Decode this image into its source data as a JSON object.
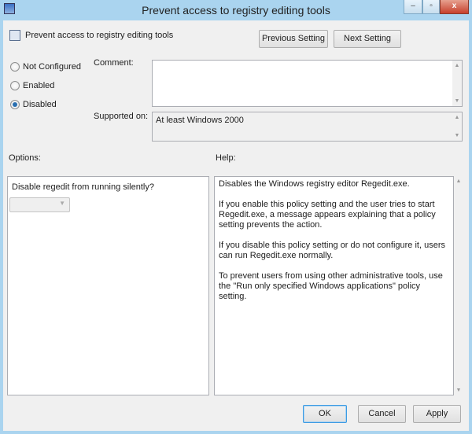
{
  "window": {
    "title": "Prevent access to registry editing tools",
    "minimize": "–",
    "maximize": "▫",
    "close": "x"
  },
  "header": {
    "policy_name": "Prevent access to registry editing tools",
    "previous_label": "Previous Setting",
    "next_label": "Next Setting"
  },
  "state": {
    "options": [
      {
        "label": "Not Configured",
        "selected": false
      },
      {
        "label": "Enabled",
        "selected": false
      },
      {
        "label": "Disabled",
        "selected": true
      }
    ]
  },
  "comment": {
    "label": "Comment:",
    "value": ""
  },
  "supported": {
    "label": "Supported on:",
    "value": "At least Windows 2000"
  },
  "options_panel": {
    "label": "Options:",
    "question": "Disable regedit from running silently?",
    "dropdown_value": ""
  },
  "help_panel": {
    "label": "Help:",
    "paragraphs": [
      "Disables the Windows registry editor Regedit.exe.",
      "If you enable this policy setting and the user tries to start Regedit.exe, a message appears explaining that a policy setting prevents the action.",
      "If you disable this policy setting or do not configure it, users can run Regedit.exe normally.",
      "To prevent users from using other administrative tools, use the \"Run only specified Windows applications\" policy setting."
    ]
  },
  "footer": {
    "ok": "OK",
    "cancel": "Cancel",
    "apply": "Apply"
  }
}
